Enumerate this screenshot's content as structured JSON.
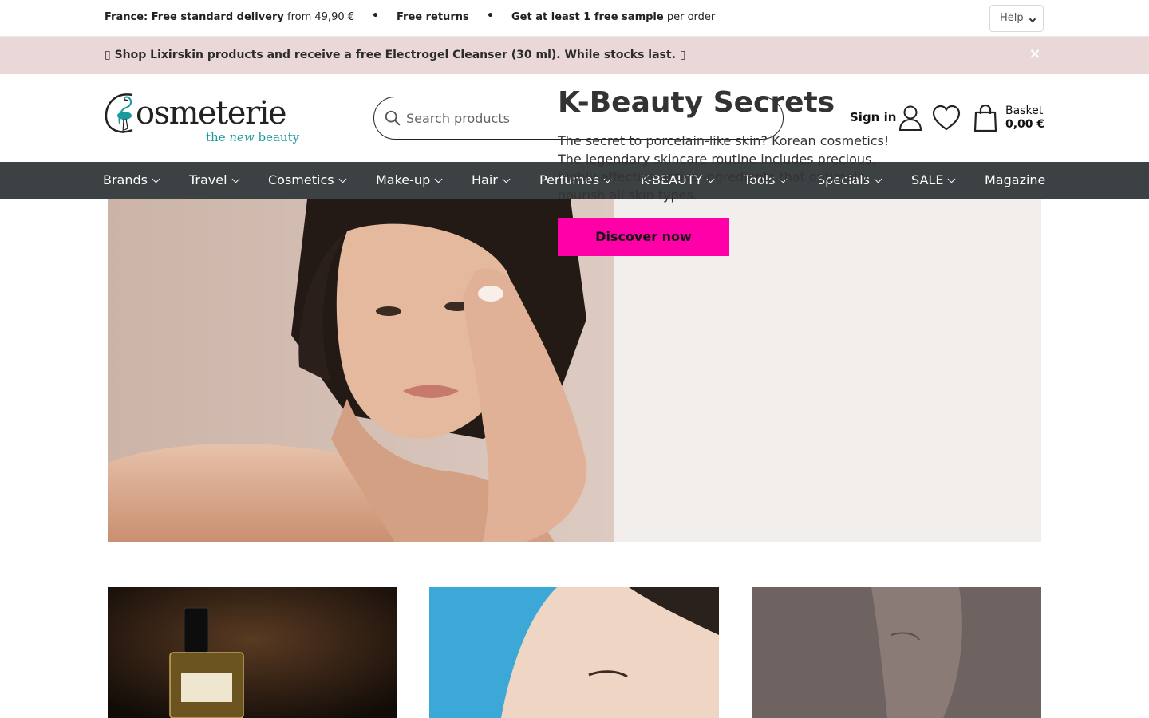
{
  "topbar": {
    "usps": [
      {
        "bold": "France: Free standard delivery",
        "rest": " from 49,90 €"
      },
      {
        "bold": "Free returns",
        "rest": ""
      },
      {
        "bold": "Get at least 1 free sample",
        "rest": " per order"
      }
    ],
    "help_label": "Help"
  },
  "promo": {
    "text": "▯ Shop Lixirskin products and receive a free Electrogel Cleanser (30 ml). While stocks last. ▯",
    "close_symbol": "×"
  },
  "header": {
    "logo_text": "Cosmeterie",
    "logo_tagline": "the new beauty",
    "search_placeholder": "Search products",
    "signin_label": "Sign in",
    "basket_label": "Basket",
    "basket_total": "0,00 €"
  },
  "nav": {
    "items": [
      {
        "label": "Brands",
        "dropdown": true
      },
      {
        "label": "Travel",
        "dropdown": true
      },
      {
        "label": "Cosmetics",
        "dropdown": true
      },
      {
        "label": "Make-up",
        "dropdown": true
      },
      {
        "label": "Hair",
        "dropdown": true
      },
      {
        "label": "Perfumes",
        "dropdown": true
      },
      {
        "label": "K-BEAUTY",
        "dropdown": true
      },
      {
        "label": "Tools",
        "dropdown": true
      },
      {
        "label": "Specials",
        "dropdown": true
      },
      {
        "label": "SALE",
        "dropdown": true
      },
      {
        "label": "Magazine",
        "dropdown": false
      }
    ]
  },
  "hero": {
    "title": "K-Beauty Secrets",
    "text": "The secret to porcelain-like skin? Korean cosmetics! The legendary skincare routine includes precious, highly effective active ingredients that optimally nourish all skin types.",
    "cta_label": "Discover now"
  },
  "colors": {
    "nav_bg": "#3c4143",
    "promo_bg": "#ead8d8",
    "cta_bg": "#ff00a8",
    "logo_teal": "#1a9a9c"
  }
}
